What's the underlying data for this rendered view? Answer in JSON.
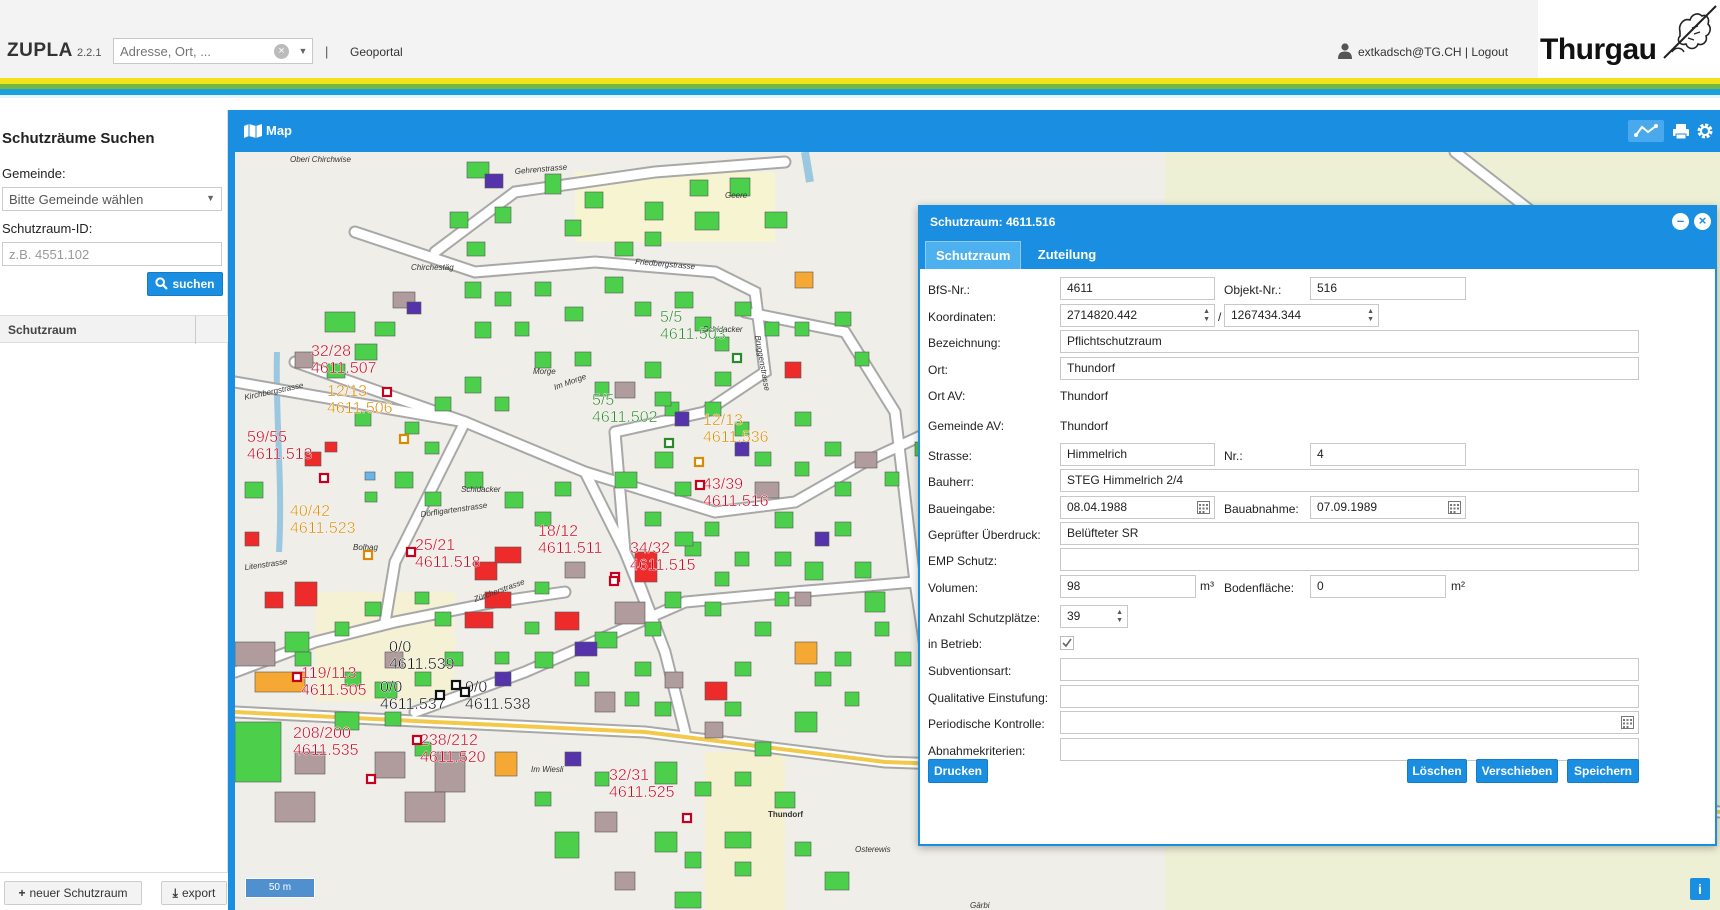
{
  "header": {
    "app_title": "ZUPLA",
    "app_version": "2.2.1",
    "search_placeholder": "Adresse, Ort, ...",
    "separator": "|",
    "geoportal_label": "Geoportal",
    "user_label": "extkadsch@TG.CH | Logout",
    "logo_text": "Thurgau"
  },
  "colors": {
    "brand_blue": "#1a8ee0",
    "stripe_yellow": "#f1e21b",
    "stripe_green": "#74b843",
    "stripe_blue": "#1aa0e0",
    "building_green": "#4cd04c",
    "building_red": "#ee2b2b",
    "building_orange": "#f5a833",
    "building_purple": "#5533aa",
    "label_red": "#c8001e",
    "label_orange": "#d98a00",
    "label_green": "#2a8a2a"
  },
  "sidebar": {
    "title": "Schutzräume Suchen",
    "gemeinde_label": "Gemeinde:",
    "gemeinde_placeholder": "Bitte Gemeinde wählen",
    "id_label": "Schutzraum-ID:",
    "id_placeholder": "z.B. 4551.102",
    "search_button": "suchen",
    "grid_column": "Schutzraum",
    "new_button": "neuer Schutzraum",
    "export_button": "export"
  },
  "map": {
    "title": "Map",
    "scale_label": "50 m",
    "info_label": "i",
    "street_labels": [
      "Oberi Chirchwise",
      "Chirchestäg",
      "Gehrenstrasse",
      "Friedbergstrasse",
      "Schidacker",
      "Geere",
      "Morge",
      "Schidacker",
      "Bolhag",
      "Thundorf",
      "Osterewis",
      "Gärbi",
      "Im Morge",
      "Kirchbergstrasse",
      "Dörfligartenstrasse",
      "Bruggenstrasse",
      "Zürcherstrasse",
      "Im Wiesli",
      "Litenstrasse"
    ],
    "shelter_labels": [
      {
        "count": "32/28",
        "id": "4611.507",
        "color": "red"
      },
      {
        "count": "12/13",
        "id": "4611.506",
        "color": "orange"
      },
      {
        "count": "59/55",
        "id": "4611.513",
        "color": "red"
      },
      {
        "count": "40/42",
        "id": "4611.523",
        "color": "orange"
      },
      {
        "count": "25/21",
        "id": "4611.518",
        "color": "red"
      },
      {
        "count": "5/5",
        "id": "4611.503",
        "color": "green"
      },
      {
        "count": "5/5",
        "id": "4611.502",
        "color": "green"
      },
      {
        "count": "12/13",
        "id": "4611.536",
        "color": "orange"
      },
      {
        "count": "43/39",
        "id": "4611.516",
        "color": "red"
      },
      {
        "count": "18/12",
        "id": "4611.511",
        "color": "red"
      },
      {
        "count": "34/32",
        "id": "4611.515",
        "color": "red"
      },
      {
        "count": "0/0",
        "id": "4611.539",
        "color": "black"
      },
      {
        "count": "119/113",
        "id": "4611.505",
        "color": "red"
      },
      {
        "count": "0/0",
        "id": "4611.537",
        "color": "black"
      },
      {
        "count": "0/0",
        "id": "4611.538",
        "color": "black"
      },
      {
        "count": "208/200",
        "id": "4611.535",
        "color": "red"
      },
      {
        "count": "238/212",
        "id": "4611.520",
        "color": "red"
      },
      {
        "count": "32/31",
        "id": "4611.525",
        "color": "red"
      }
    ]
  },
  "dialog": {
    "title": "Schutzraum: 4611.516",
    "tabs": [
      "Schutzraum",
      "Zuteilung"
    ],
    "fields": {
      "bfs_label": "BfS-Nr.:",
      "bfs_value": "4611",
      "objekt_label": "Objekt-Nr.:",
      "objekt_value": "516",
      "koord_label": "Koordinaten:",
      "koord_x": "2714820.442",
      "koord_sep": "/",
      "koord_y": "1267434.344",
      "bezeichnung_label": "Bezeichnung:",
      "bezeichnung_value": "Pflichtschutzraum",
      "ort_label": "Ort:",
      "ort_value": "Thundorf",
      "ort_av_label": "Ort AV:",
      "ort_av_value": "Thundorf",
      "gemeinde_av_label": "Gemeinde AV:",
      "gemeinde_av_value": "Thundorf",
      "strasse_label": "Strasse:",
      "strasse_value": "Himmelrich",
      "nr_label": "Nr.:",
      "nr_value": "4",
      "bauherr_label": "Bauherr:",
      "bauherr_value": "STEG Himmelrich 2/4",
      "baueingabe_label": "Baueingabe:",
      "baueingabe_value": "08.04.1988",
      "bauabnahme_label": "Bauabnahme:",
      "bauabnahme_value": "07.09.1989",
      "ueberdruck_label": "Geprüfter Überdruck:",
      "ueberdruck_value": "Belüfteter SR",
      "emp_label": "EMP Schutz:",
      "emp_value": "",
      "volumen_label": "Volumen:",
      "volumen_value": "98",
      "volumen_unit": "m³",
      "boden_label": "Bodenfläche:",
      "boden_value": "0",
      "boden_unit": "m²",
      "plaetze_label": "Anzahl Schutzplätze:",
      "plaetze_value": "39",
      "betrieb_label": "in Betrieb:",
      "subvention_label": "Subventionsart:",
      "subvention_value": "",
      "einstufung_label": "Qualitative Einstufung:",
      "einstufung_value": "",
      "kontrolle_label": "Periodische Kontrolle:",
      "kontrolle_value": "",
      "abnahme_label": "Abnahmekriterien:",
      "abnahme_value": ""
    },
    "buttons": {
      "drucken": "Drucken",
      "loeschen": "Löschen",
      "verschieben": "Verschieben",
      "speichern": "Speichern"
    }
  }
}
